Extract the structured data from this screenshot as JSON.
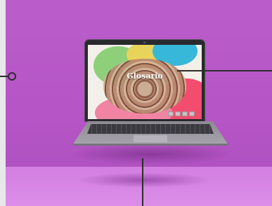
{
  "screen": {
    "title": "Glosario"
  },
  "colors": {
    "background": "#b557c6",
    "floor": "#d884e5",
    "laptop_body": "#2a2a2e",
    "leader_lines": "#2c2c2c"
  },
  "icons": {
    "nav_buttons": [
      "first-icon",
      "prev-icon",
      "next-icon",
      "last-icon"
    ]
  }
}
